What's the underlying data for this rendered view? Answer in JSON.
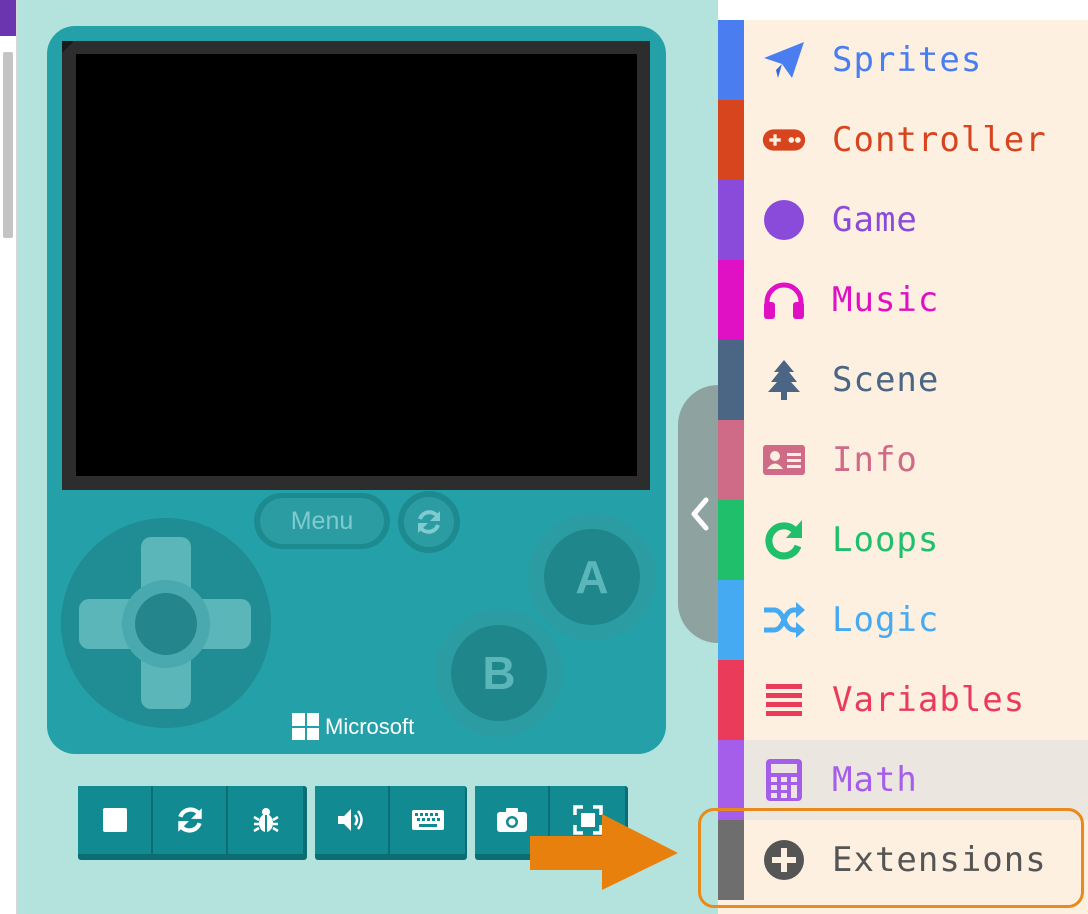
{
  "simulator": {
    "menu_label": "Menu",
    "a_label": "A",
    "b_label": "B",
    "brand": "Microsoft"
  },
  "toolbar": {
    "buttons": [
      "stop-icon",
      "restart-icon",
      "debug-icon",
      "sound-icon",
      "keyboard-icon",
      "screenshot-icon",
      "fullscreen-icon"
    ]
  },
  "toolbox": {
    "categories": [
      {
        "label": "Sprites",
        "icon": "paper-plane-icon",
        "color": "#4a7ef0"
      },
      {
        "label": "Controller",
        "icon": "gamepad-icon",
        "color": "#d6451e"
      },
      {
        "label": "Game",
        "icon": "circle-icon",
        "color": "#8a4bdb"
      },
      {
        "label": "Music",
        "icon": "headphones-icon",
        "color": "#e010c4"
      },
      {
        "label": "Scene",
        "icon": "tree-icon",
        "color": "#4b6584"
      },
      {
        "label": "Info",
        "icon": "id-card-icon",
        "color": "#cf6a87"
      },
      {
        "label": "Loops",
        "icon": "redo-icon",
        "color": "#20bf6b"
      },
      {
        "label": "Logic",
        "icon": "shuffle-icon",
        "color": "#45aaf2"
      },
      {
        "label": "Variables",
        "icon": "list-icon",
        "color": "#eb3b5a"
      },
      {
        "label": "Math",
        "icon": "calculator-icon",
        "color": "#a55eea"
      },
      {
        "label": "Extensions",
        "icon": "plus-circle-icon",
        "color": "#6e6e6e"
      }
    ]
  },
  "colors": {
    "highlight": "#e88a1c",
    "device": "#24a0a8",
    "page_bg": "#b3e3dc"
  }
}
